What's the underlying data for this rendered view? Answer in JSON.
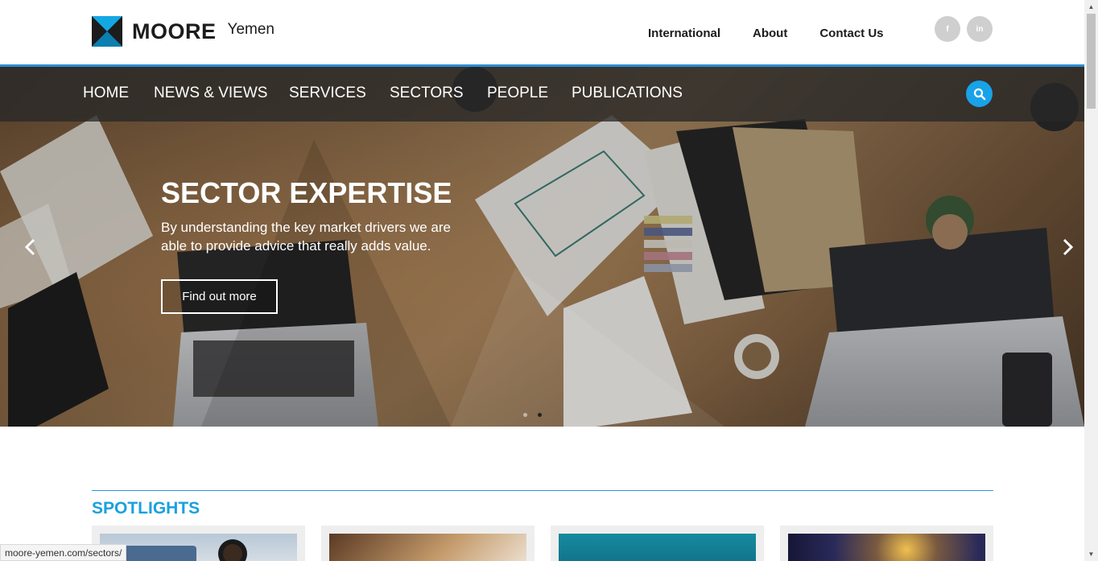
{
  "brand": {
    "word": "MOORE",
    "country": "Yemen",
    "colors": {
      "logo_blue": "#14a8e3",
      "logo_dark": "#1c1c1c",
      "accent": "#1aa0e0"
    }
  },
  "top_links": [
    "International",
    "About",
    "Contact Us"
  ],
  "social": [
    {
      "icon": "facebook-icon",
      "glyph": "f"
    },
    {
      "icon": "linkedin-icon",
      "glyph": "in"
    }
  ],
  "nav": [
    "HOME",
    "NEWS & VIEWS",
    "SERVICES",
    "SECTORS",
    "PEOPLE",
    "PUBLICATIONS"
  ],
  "hero": {
    "title": "SECTOR EXPERTISE",
    "text": "By understanding the key market drivers we are able to provide advice that really adds value.",
    "button": "Find out more",
    "active_slide": 2,
    "slide_count": 2
  },
  "spotlights": {
    "title": "SPOTLIGHTS",
    "cards": [
      "card-1",
      "card-2",
      "card-3",
      "card-4"
    ]
  },
  "status_bar": "moore-yemen.com/sectors/"
}
